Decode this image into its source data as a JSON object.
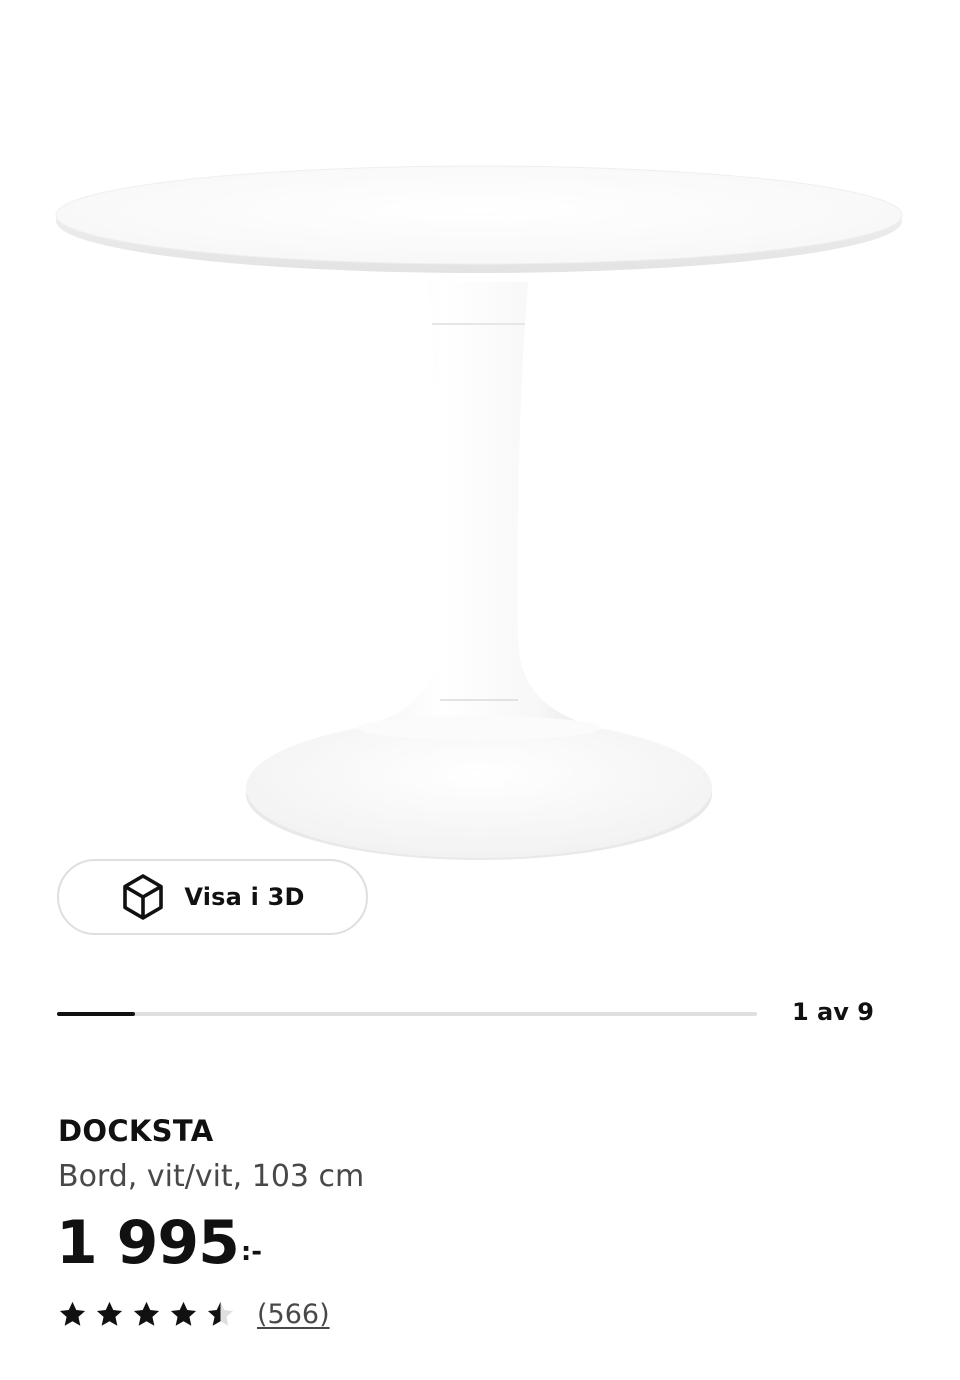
{
  "gallery": {
    "image_alt": "DOCKSTA",
    "view_3d_label": "Visa i 3D",
    "position_text": "1 av 9",
    "current_index": 1,
    "total_images": 9
  },
  "product": {
    "name": "DOCKSTA",
    "description": "Bord, vit/vit, 103 cm",
    "price_integer": "1 995",
    "price_suffix": ":-"
  },
  "rating": {
    "score": 4.5,
    "max": 5,
    "review_count_label": "(566)"
  },
  "colors": {
    "text": "#111111",
    "secondary_text": "#484848",
    "border": "#dfdfdf",
    "star": "#111111",
    "star_empty": "#dfdfdf"
  },
  "icons": {
    "view_3d": "cube-icon",
    "rating": "star-icon"
  }
}
